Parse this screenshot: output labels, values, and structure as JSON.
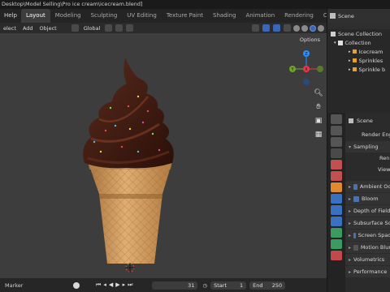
{
  "window": {
    "title": "Desktop\\Model Selling\\Pro ice cream\\icecream.blend]"
  },
  "topbar": {
    "menus": [
      "Help"
    ],
    "workspace_tabs": [
      {
        "label": "Layout",
        "active": true
      },
      {
        "label": "Modeling",
        "active": false
      },
      {
        "label": "Sculpting",
        "active": false
      },
      {
        "label": "UV Editing",
        "active": false
      },
      {
        "label": "Texture Paint",
        "active": false
      },
      {
        "label": "Shading",
        "active": false
      },
      {
        "label": "Animation",
        "active": false
      },
      {
        "label": "Rendering",
        "active": false
      },
      {
        "label": "Compositin",
        "active": false
      }
    ]
  },
  "viewport_header": {
    "select_label": "elect",
    "add_label": "Add",
    "object_label": "Object",
    "transform_orientation": "Global",
    "options_label": "Options"
  },
  "gizmo": {
    "z_label": "Z",
    "y_label": "Y",
    "x_label": "X",
    "colors": {
      "x": "#e8394a",
      "y": "#6ea62b",
      "z": "#2c8fff"
    }
  },
  "timeline": {
    "marker_label": "Marker",
    "current_frame": "31",
    "start_label": "Start",
    "start_value": "1",
    "end_label": "End",
    "end_value": "250"
  },
  "outliner": {
    "header": "Scene",
    "items": [
      {
        "label": "Scene Collection",
        "indent": 0
      },
      {
        "label": "Collection",
        "indent": 1
      },
      {
        "label": "Icecream",
        "indent": 2
      },
      {
        "label": "Sprinkles",
        "indent": 2
      },
      {
        "label": "Sprinkle b",
        "indent": 2
      }
    ]
  },
  "properties": {
    "scene_label": "Scene",
    "render_engine_label": "Render Eng",
    "sampling_label": "Sampling",
    "render_label": "Ren",
    "viewport_label": "View",
    "panels": [
      {
        "label": "Ambient Oc",
        "checkbox": true,
        "checked": true
      },
      {
        "label": "Bloom",
        "checkbox": true,
        "checked": true
      },
      {
        "label": "Depth of Field",
        "checkbox": false,
        "checked": false
      },
      {
        "label": "Subsurface Sca",
        "checkbox": false,
        "checked": false
      },
      {
        "label": "Screen Spac",
        "checkbox": true,
        "checked": true
      },
      {
        "label": "Motion Blur",
        "checkbox": true,
        "checked": false
      },
      {
        "label": "Volumetrics",
        "checkbox": false,
        "checked": false
      },
      {
        "label": "Performance",
        "checkbox": false,
        "checked": false
      }
    ]
  }
}
